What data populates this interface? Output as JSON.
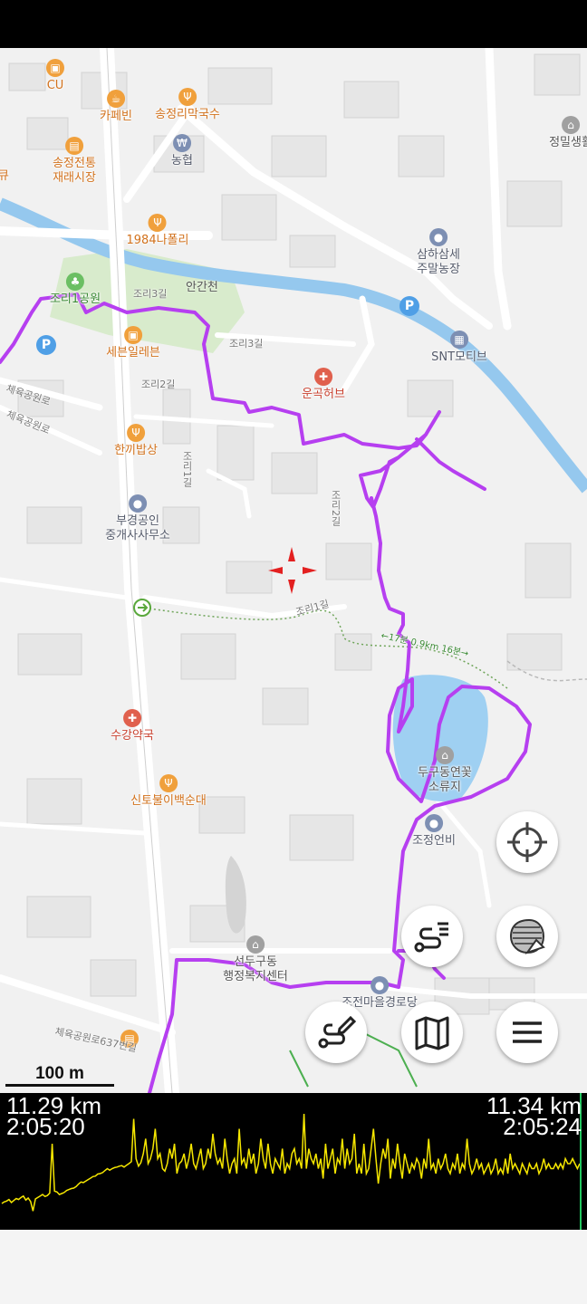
{
  "colors": {
    "track": "#b63ff0",
    "river": "#95c8ee",
    "pond": "#9fd0f2",
    "park": "#d8ebcc",
    "elev_line": "#f5e600",
    "end_marker": "#22c55e",
    "crosshair": "#e32020"
  },
  "pois": [
    {
      "id": "cu",
      "label": "CU",
      "icon": "convenience-store-icon",
      "color": "or"
    },
    {
      "id": "cafe",
      "label": "카페빈",
      "icon": "cafe-icon",
      "color": "or"
    },
    {
      "id": "noodle",
      "label": "송정리막국수",
      "icon": "restaurant-icon",
      "color": "or"
    },
    {
      "id": "market",
      "label": "송정전통\n재래시장",
      "icon": "market-icon",
      "color": "or"
    },
    {
      "id": "bank",
      "label": "농협",
      "icon": "bank-icon",
      "color": "bl"
    },
    {
      "id": "napoli",
      "label": "1984나폴리",
      "icon": "restaurant-icon",
      "color": "or"
    },
    {
      "id": "farm",
      "label": "삼하삼세\n주말농장",
      "icon": "place-icon",
      "color": "bl"
    },
    {
      "id": "park",
      "label": "조리1공원",
      "icon": "park-icon",
      "color": "gr"
    },
    {
      "id": "seven",
      "label": "세븐일레븐",
      "icon": "convenience-store-icon",
      "color": "or"
    },
    {
      "id": "herb",
      "label": "운곡허브",
      "icon": "pharmacy-icon",
      "color": "rd"
    },
    {
      "id": "snt",
      "label": "SNT모티브",
      "icon": "building-icon",
      "color": "bl"
    },
    {
      "id": "hankki",
      "label": "한끼밥상",
      "icon": "restaurant-icon",
      "color": "or"
    },
    {
      "id": "realtor",
      "label": "부경공인\n중개사사무소",
      "icon": "place-icon",
      "color": "bl"
    },
    {
      "id": "pharm",
      "label": "수강약국",
      "icon": "pharmacy-icon",
      "color": "rd"
    },
    {
      "id": "sundae",
      "label": "신토불이백순대",
      "icon": "restaurant-icon",
      "color": "or"
    },
    {
      "id": "pond",
      "label": "두구동연꽃\n소류지",
      "icon": "landmark-icon",
      "color": "gy"
    },
    {
      "id": "monument",
      "label": "조정언비",
      "icon": "place-icon",
      "color": "bl"
    },
    {
      "id": "center",
      "label": "선두구동\n행정복지센터",
      "icon": "government-icon",
      "color": "gy"
    },
    {
      "id": "hall",
      "label": "조전마을경로당",
      "icon": "place-icon",
      "color": "bl"
    },
    {
      "id": "life",
      "label": "정밀생활",
      "icon": "landmark-icon",
      "color": "gy"
    },
    {
      "id": "q",
      "label": "큐",
      "icon": "",
      "color": "or"
    }
  ],
  "roads": {
    "r1": "조리3길",
    "r2": "조리3길",
    "r3": "조리2길",
    "r4": "조리1길",
    "r5": "조리2길",
    "r6": "조리1길",
    "r7": "체육공원로",
    "r8": "체육공원로",
    "r9": "체육공원로637번길",
    "river": "안간천"
  },
  "trail_label": "←17분 0.9km 16분→",
  "scale_bar": {
    "label": "100 m"
  },
  "buttons": {
    "locate": "crosshair-icon",
    "layers": "layers-icon",
    "route": "route-list-icon",
    "draw": "route-edit-icon",
    "map": "map-icon",
    "menu": "menu-icon"
  },
  "elevation": {
    "left_distance": "11.29 km",
    "left_time": "2:05:20",
    "right_distance": "11.34 km",
    "right_time": "2:05:24",
    "profile": [
      0,
      0.3,
      0.5,
      0.8,
      0.2,
      0.6,
      1.0,
      0.8,
      1.2,
      1.5,
      0.7,
      1.1,
      0.4,
      -1.5,
      0.9,
      1.2,
      1.5,
      1.8,
      1.4,
      1.6,
      2.1,
      12,
      2.5,
      2.3,
      1.8,
      2.0,
      2.2,
      2.6,
      2.8,
      3.0,
      3.1,
      3.4,
      3.9,
      4.3,
      4.2,
      4.5,
      4.8,
      5.1,
      5.4,
      5.5,
      5.9,
      6.0,
      6.2,
      6.6,
      7.0,
      6.7,
      7.0,
      7.2,
      7.3,
      7.5,
      7.6,
      7.3,
      7.7,
      8.0,
      8.4,
      17,
      9,
      7.5,
      8.2,
      10,
      13,
      8,
      9,
      11,
      15,
      9,
      10,
      7,
      6.5,
      8,
      11,
      9,
      12,
      6,
      8,
      8.5,
      10,
      7,
      9,
      12,
      8,
      7,
      9,
      11,
      7,
      8,
      11,
      9,
      14,
      10,
      8,
      9,
      7,
      13,
      9,
      6,
      8,
      9,
      6,
      15,
      8,
      9,
      7,
      11,
      8,
      10,
      6,
      8,
      13,
      9,
      7,
      12,
      8,
      6,
      9,
      8,
      7,
      11,
      6,
      8,
      7,
      10,
      11,
      8,
      9,
      7,
      18,
      7,
      11,
      9,
      8,
      10,
      7,
      9,
      5,
      12,
      7,
      9,
      11,
      6,
      9,
      8,
      13,
      7,
      11,
      8,
      9,
      14,
      6,
      8,
      6,
      12,
      6,
      7,
      11,
      15,
      9,
      4,
      8,
      11,
      9,
      13,
      5,
      9,
      7,
      12,
      8,
      5,
      10,
      8,
      6,
      8,
      7,
      9,
      8,
      5,
      9,
      7,
      13,
      7,
      8,
      6,
      9,
      7,
      8,
      10,
      7,
      6,
      8,
      7,
      10,
      6,
      8,
      7,
      13,
      8,
      6,
      7,
      9,
      7,
      8,
      6,
      7,
      8,
      6,
      7,
      9,
      6,
      7,
      6,
      9,
      6,
      10,
      7,
      8,
      7,
      6,
      8,
      7,
      6,
      8,
      7,
      7,
      8,
      6,
      7,
      9,
      7,
      8,
      7,
      7,
      8,
      7,
      8,
      7,
      9,
      8,
      8,
      9,
      8,
      7,
      8
    ]
  }
}
